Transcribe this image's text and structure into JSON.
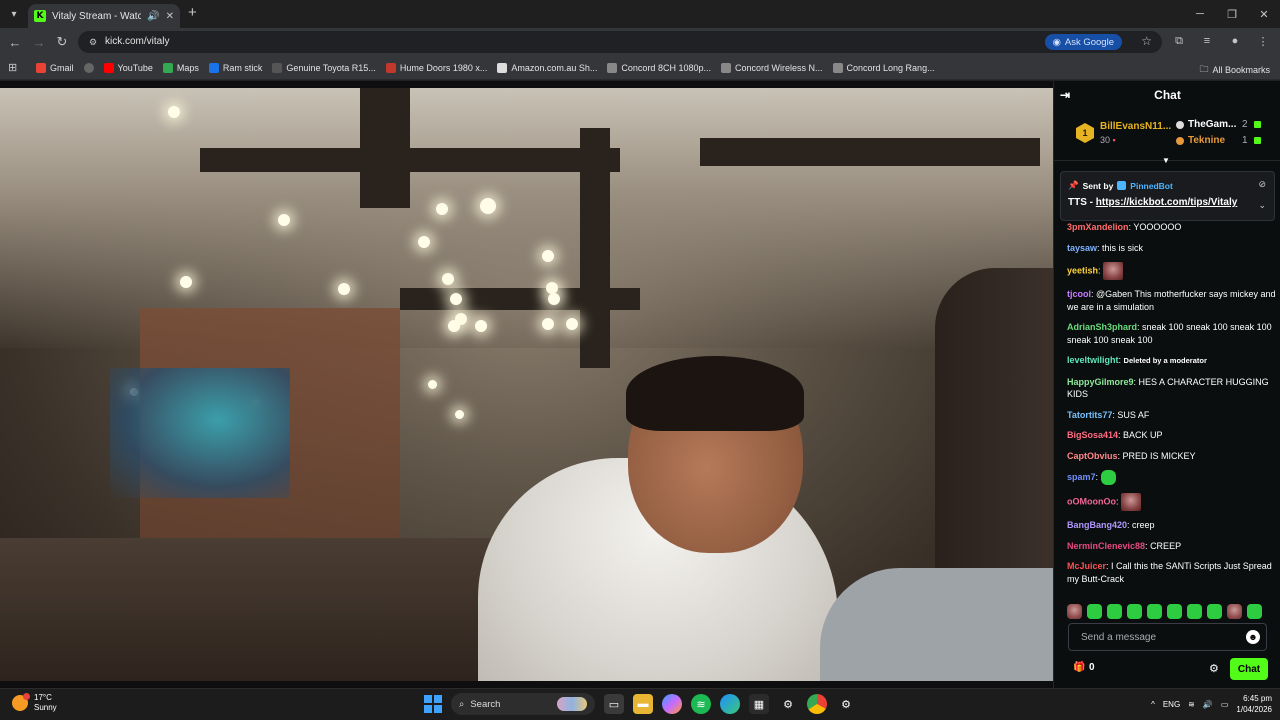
{
  "browser": {
    "tab_title": "Vitaly Stream - Watch Live",
    "url": "kick.com/vitaly",
    "ask_google": "Ask Google",
    "bookmarks": [
      "Gmail",
      "YouTube",
      "Maps",
      "Ram stick",
      "Genuine Toyota R15...",
      "Hume Doors 1980 x...",
      "Amazon.com.au Sh...",
      "Concord 8CH 1080p...",
      "Concord Wireless N...",
      "Concord Long Rang..."
    ],
    "all_bookmarks": "All Bookmarks"
  },
  "chat": {
    "title": "Chat",
    "leaderboard": {
      "first": {
        "rank": "1",
        "name": "BillEvansN11...",
        "count": "30"
      },
      "second": {
        "name": "TheGam...",
        "count": "2"
      },
      "third": {
        "name": "Teknine",
        "count": "1"
      }
    },
    "pinned": {
      "sent_by": "Sent by",
      "bot": "PinnedBot",
      "prefix": "TTS - ",
      "link": "https://kickbot.com/tips/Vitaly"
    },
    "messages": [
      {
        "user": "3pmXandelion",
        "color": "#ff6b6b",
        "text": "YOOOOOO"
      },
      {
        "user": "taysaw",
        "color": "#7fb2ff",
        "text": "this is sick"
      },
      {
        "user": "yeetish",
        "color": "#ffd43b",
        "text": "",
        "emote": "face"
      },
      {
        "user": "tjcool",
        "color": "#c77dff",
        "text": "@Gaben This motherfucker says mickey and we are in a simulation"
      },
      {
        "user": "AdrianSh3phard",
        "color": "#69db7c",
        "text": "sneak 100 sneak 100 sneak 100 sneak 100 sneak 100"
      },
      {
        "user": "leveltwilight",
        "color": "#63e6be",
        "text": "Deleted by a moderator",
        "small": true
      },
      {
        "user": "HappyGilmore9",
        "color": "#8ce99a",
        "text": "HES A CHARACTER HUGGING KIDS"
      },
      {
        "user": "Tatortits77",
        "color": "#74c0fc",
        "text": "SUS AF"
      },
      {
        "user": "BigSosa414",
        "color": "#ff6b81",
        "text": "BACK UP"
      },
      {
        "user": "CaptObvius",
        "color": "#ff8787",
        "text": "PRED IS MICKEY"
      },
      {
        "user": "spam7",
        "color": "#748ffc",
        "text": "",
        "emote": "green"
      },
      {
        "user": "oOMoonOo",
        "color": "#f06595",
        "text": "",
        "emote": "face"
      },
      {
        "user": "BangBang420",
        "color": "#b197fc",
        "text": "creep"
      },
      {
        "user": "NerminClenevic88",
        "color": "#e64980",
        "text": "CREEP"
      },
      {
        "user": "McJuicer",
        "color": "#fa5252",
        "text": "I Call this the SANTi Scripts  Just Spread my Butt-Crack"
      }
    ],
    "input_placeholder": "Send a message",
    "gift_count": "0",
    "send_label": "Chat"
  },
  "taskbar": {
    "temperature": "17°C",
    "condition": "Sunny",
    "search_label": "Search",
    "lang": "ENG",
    "time": "6:45 pm",
    "date": "1/04/2026"
  }
}
